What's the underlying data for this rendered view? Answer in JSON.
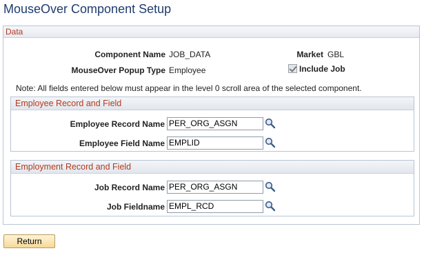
{
  "page": {
    "title": "MouseOver Component Setup"
  },
  "data_section": {
    "title": "Data",
    "component_name_label": "Component Name",
    "component_name_value": "JOB_DATA",
    "market_label": "Market",
    "market_value": "GBL",
    "popup_type_label": "MouseOver Popup Type",
    "popup_type_value": "Employee",
    "include_job_label": "Include Job",
    "include_job_checked": true,
    "note": "Note:  All fields entered below must appear in the level 0 scroll area of the selected component."
  },
  "employee_group": {
    "title": "Employee Record and Field",
    "record_label": "Employee Record Name",
    "record_value": "PER_ORG_ASGN",
    "field_label": "Employee Field Name",
    "field_value": "EMPLID"
  },
  "employment_group": {
    "title": "Employment Record and Field",
    "record_label": "Job Record Name",
    "record_value": "PER_ORG_ASGN",
    "field_label": "Job Fieldname",
    "field_value": "EMPL_RCD"
  },
  "actions": {
    "return_label": "Return"
  },
  "icons": {
    "lookup": "magnifier-lookup-icon"
  },
  "colors": {
    "title": "#1f3c6e",
    "section_header_text": "#b23a1f",
    "return_button": "#f6d99a"
  }
}
